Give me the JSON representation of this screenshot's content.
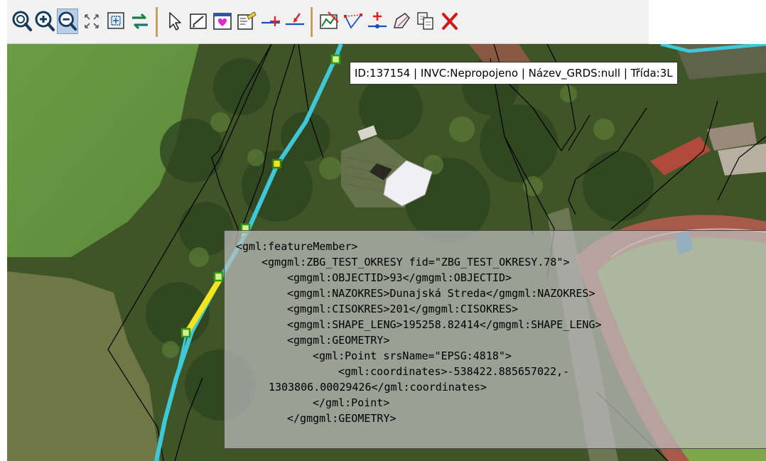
{
  "toolbar": {
    "buttons": [
      {
        "name": "zoom-extent-icon",
        "tooltip": ""
      },
      {
        "name": "zoom-in-icon",
        "tooltip": ""
      },
      {
        "name": "zoom-out-icon",
        "tooltip": ""
      },
      {
        "name": "zoom-full-icon",
        "tooltip": ""
      },
      {
        "name": "zoom-window-icon",
        "tooltip": ""
      },
      {
        "name": "refresh-arrows-icon",
        "tooltip": ""
      },
      {
        "name": "select-arrow-icon",
        "tooltip": ""
      },
      {
        "name": "select-edit-icon",
        "tooltip": ""
      },
      {
        "name": "feature-info-icon",
        "tooltip": ""
      },
      {
        "name": "attribute-form-icon",
        "tooltip": ""
      },
      {
        "name": "add-vertex-icon",
        "tooltip": ""
      },
      {
        "name": "snap-point-icon",
        "tooltip": ""
      },
      {
        "name": "edit-geometry-icon",
        "tooltip": ""
      },
      {
        "name": "edit-line-icon",
        "tooltip": ""
      },
      {
        "name": "add-node-icon",
        "tooltip": ""
      },
      {
        "name": "draw-polygon-icon",
        "tooltip": ""
      },
      {
        "name": "copy-feature-icon",
        "tooltip": ""
      },
      {
        "name": "delete-icon",
        "tooltip": ""
      }
    ]
  },
  "map": {
    "tooltip_text": "ID:137154 | INVC:Nepropojeno | Název_GRDS:null | Třída:3L",
    "gml_lines": [
      "<gml:featureMember>",
      "<gmgml:ZBG_TEST_OKRESY fid=\"ZBG_TEST_OKRESY.78\">",
      "<gmgml:OBJECTID>93</gmgml:OBJECTID>",
      "<gmgml:NAZOKRES>Dunajská Streda</gmgml:NAZOKRES>",
      "<gmgml:CISOKRES>201</gmgml:CISOKRES>",
      "<gmgml:SHAPE_LENG>195258.82414</gmgml:SHAPE_LENG>",
      "<gmgml:GEOMETRY>",
      "<gml:Point srsName=\"EPSG:4818\">",
      "<gml:coordinates>-538422.885657022,-",
      "1303806.00029426</gml:coordinates>",
      "</gml:Point>",
      "</gmgml:GEOMETRY>"
    ],
    "colors": {
      "network_line": "#3ec8d8",
      "selected_segment": "#f5e41a",
      "vertex": "#2f9a1e",
      "boundary": "#000000"
    }
  }
}
